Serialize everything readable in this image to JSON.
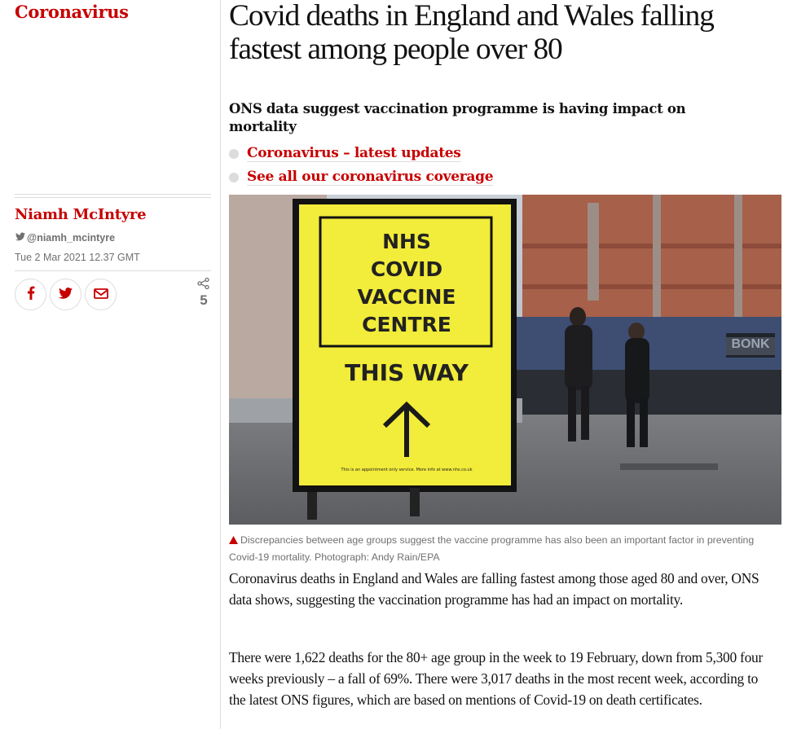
{
  "section": {
    "label": "Coronavirus"
  },
  "byline": {
    "author": "Niamh McIntyre",
    "twitter_handle": "@niamh_mcintyre",
    "published": "Tue 2 Mar 2021 12.37 GMT"
  },
  "share": {
    "buttons": [
      {
        "name": "facebook",
        "icon": "facebook-icon"
      },
      {
        "name": "twitter",
        "icon": "twitter-icon"
      },
      {
        "name": "email",
        "icon": "email-icon"
      }
    ],
    "count": "5",
    "count_icon": "share-icon"
  },
  "article": {
    "headline": "Covid deaths in England and Wales falling fastest among people over 80",
    "standfirst": "ONS data suggest vaccination programme is having impact on mortality",
    "related_links": [
      "Coronavirus – latest updates",
      "See all our coronavirus coverage"
    ],
    "image": {
      "sign_lines": [
        "NHS",
        "COVID",
        "VACCINE",
        "CENTRE"
      ],
      "sign_direction": "THIS WAY",
      "sign_footnote": "This is an appointment only service. More info at www.nhs.co.uk",
      "background_sign": "BONK"
    },
    "caption": "Discrepancies between age groups suggest the vaccine programme has also been an important factor in preventing Covid-19 mortality. Photograph: Andy Rain/EPA",
    "paragraphs": [
      "Coronavirus deaths in England and Wales are falling fastest among those aged 80 and over, ONS data shows, suggesting the vaccination programme has had an impact on mortality.",
      "There were 1,622 deaths for the 80+ age group in the week to 19 February, down from 5,300 four weeks previously – a fall of 69%. There were 3,017 deaths in the most recent week, according to the latest ONS figures, which are based on mentions of Covid-19 on death certificates."
    ]
  },
  "colors": {
    "accent": "#c70000",
    "meta": "#707070",
    "rule": "#dcdcdc",
    "sign": "#f2ec3a"
  }
}
